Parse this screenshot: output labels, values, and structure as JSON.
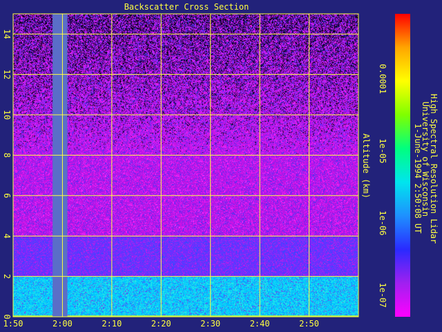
{
  "chart_data": {
    "type": "heatmap",
    "title": "Backscatter Cross Section",
    "xlabel": "",
    "ylabel": "Altitude (km)",
    "x_ticks": [
      "1:50",
      "2:00",
      "2:10",
      "2:20",
      "2:30",
      "2:40",
      "2:50"
    ],
    "x_range_minutes": [
      100,
      170
    ],
    "y_ticks": [
      0,
      2,
      4,
      6,
      8,
      10,
      12,
      14
    ],
    "ylim": [
      0,
      15
    ],
    "grid": true,
    "colorbar": {
      "scale": "log",
      "range": [
        5e-08,
        0.0008
      ],
      "tick_labels": [
        "0.0001",
        "1e-05",
        "1e-06",
        "1e-07"
      ],
      "tick_values": [
        0.0001,
        1e-05,
        1e-06,
        1e-07
      ],
      "colors": [
        "#ff00ff",
        "#a020f0",
        "#2a2aff",
        "#1e90ff",
        "#00e5ee",
        "#00ff7f",
        "#7fff00",
        "#ffff00",
        "#ffa500",
        "#ff0000"
      ]
    },
    "layers": [
      {
        "altitude_km": [
          0,
          2.0
        ],
        "level": "~5e-07"
      },
      {
        "altitude_km": [
          2.0,
          4.0
        ],
        "level": "~1.5e-07"
      },
      {
        "altitude_km": [
          4.0,
          15
        ],
        "level": "~1e-07"
      }
    ],
    "data_gap_minutes": [
      108,
      111
    ]
  },
  "annotation": {
    "line1": "University of Wisconsin",
    "line2": "High Spectral Resolution Lidar",
    "line3": "1-June-1994  2:50:08 UT"
  }
}
